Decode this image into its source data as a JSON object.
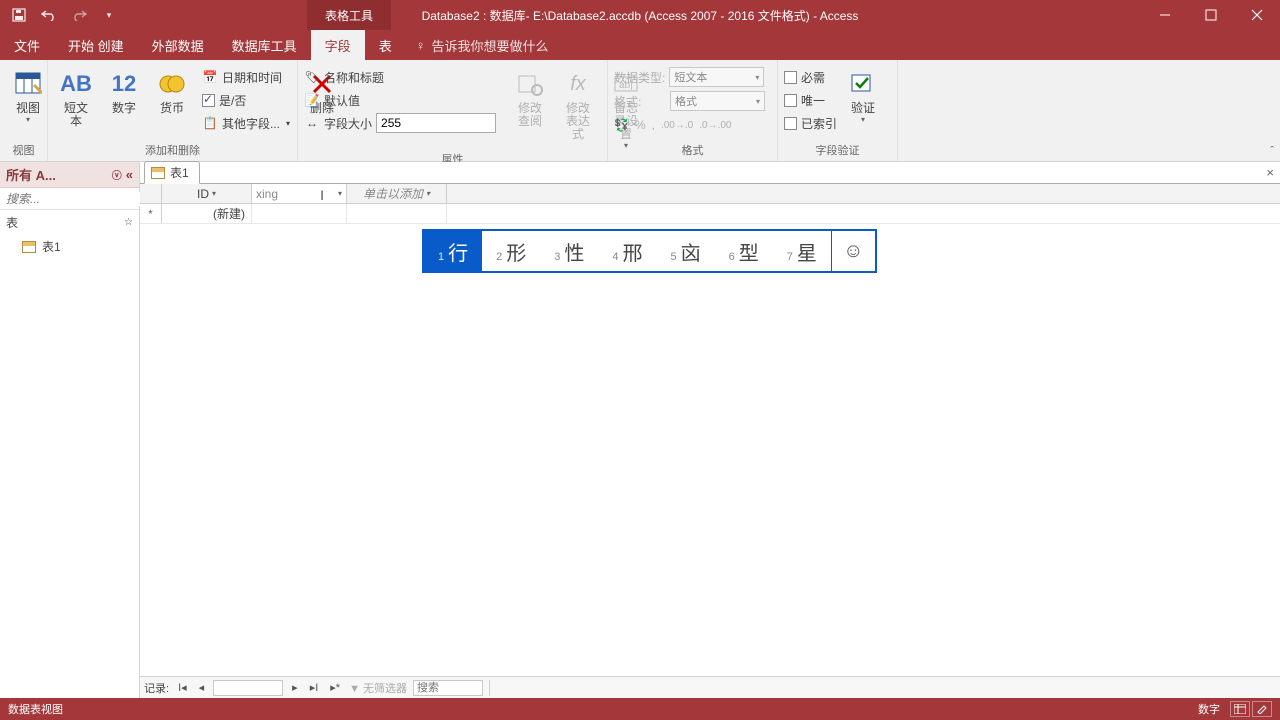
{
  "titlebar": {
    "tools_label": "表格工具",
    "title": "Database2 : 数据库- E:\\Database2.accdb (Access 2007 - 2016 文件格式) - Access"
  },
  "tabs": {
    "file": "文件",
    "t1": "开始  创建",
    "t2": "外部数据",
    "t3": "数据库工具",
    "fields": "字段",
    "table": "表",
    "tellme": "告诉我你想要做什么"
  },
  "ribbon": {
    "view_group": "视图",
    "view": "视图",
    "add_delete_group": "添加和删除",
    "short_text": "短文本",
    "number": "数字",
    "currency": "货币",
    "yes_no": "是/否",
    "date_time": "日期和时间",
    "more_fields": "其他字段...",
    "delete": "删除",
    "properties_group": "属性",
    "name_caption": "名称和标题",
    "default_value": "默认值",
    "field_size_lbl": "字段大小",
    "field_size_val": "255",
    "modify_lookups": "修改查阅",
    "modify_expr_l1": "修改",
    "modify_expr_l2": "表达式",
    "memo_settings": "备忘录设置",
    "format_group": "格式",
    "data_type_lbl": "数据类型:",
    "data_type_val": "短文本",
    "format_lbl": "格式:",
    "format_val": "格式",
    "validation_group": "字段验证",
    "required": "必需",
    "unique": "唯一",
    "indexed": "已索引",
    "validation": "验证"
  },
  "nav": {
    "title": "所有 A...",
    "search_ph": "搜索...",
    "cat": "表",
    "table1": "表1"
  },
  "doc": {
    "tab": "表1",
    "col_id": "ID",
    "col_editing_text": "xing",
    "col_add": "单击以添加",
    "new_row": "(新建)"
  },
  "ime": {
    "candidates": [
      "行",
      "形",
      "性",
      "邢",
      "㐫",
      "型",
      "星"
    ]
  },
  "recordnav": {
    "label": "记录:",
    "current": "",
    "filter": "无筛选器",
    "search": "搜索"
  },
  "status": {
    "left": "数据表视图",
    "numlock": "数字"
  }
}
